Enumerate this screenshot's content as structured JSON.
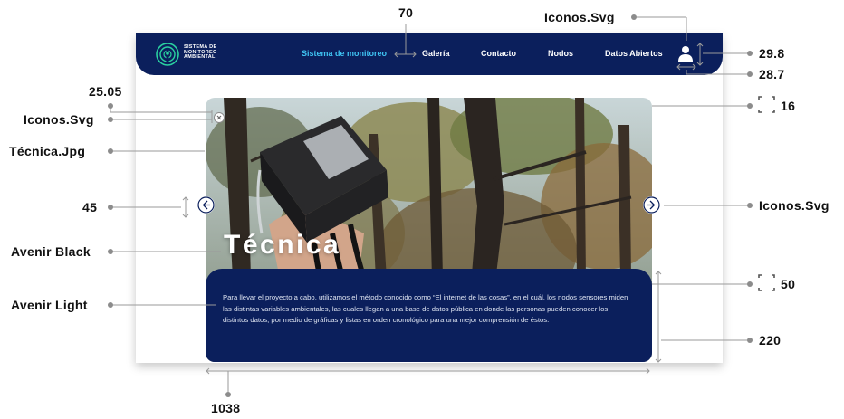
{
  "navbar": {
    "logo_lines": [
      "SISTEMA DE",
      "MONITOREO",
      "AMBIENTAL"
    ],
    "items": [
      {
        "label": "Sistema de monitoreo",
        "active": true
      },
      {
        "label": "Galería",
        "active": false
      },
      {
        "label": "Contacto",
        "active": false
      },
      {
        "label": "Nodos",
        "active": false
      },
      {
        "label": "Datos Abiertos",
        "active": false
      }
    ],
    "user_icon": "user-icon",
    "color": "#0b1f5c",
    "active_color": "#3fc3f2"
  },
  "hero": {
    "title": "Técnica",
    "description": "Para llevar el proyecto a cabo, utilizamos el método conocido como “El internet de las cosas”, en el cuál, los nodos sensores miden las distintas variables ambientales, las cuales llegan a una base de datos pública en donde las personas pueden conocer los distintos datos, por medio de gráficas y listas en orden cronológico para una mejor comprensión de éstos.",
    "close_icon": "close-icon",
    "prev_icon": "arrow-left-icon",
    "next_icon": "arrow-right-icon"
  },
  "annotations": {
    "top_70": "70",
    "iconos_top": "Iconos.Svg",
    "v_29_8": "29.8",
    "v_28_7": "28.7",
    "v_25_05": "25.05",
    "iconos_left": "Iconos.Svg",
    "tecnica_jpg": "Técnica.Jpg",
    "v_16": "16",
    "v_45": "45",
    "iconos_right": "Iconos.Svg",
    "avenir_black": "Avenir Black",
    "avenir_light": "Avenir Light",
    "v_50": "50",
    "v_220": "220",
    "v_1038": "1038"
  }
}
